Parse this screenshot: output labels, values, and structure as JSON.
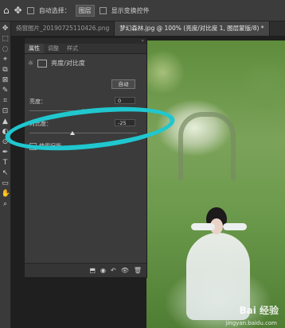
{
  "options_bar": {
    "home": "⌂",
    "move_tool": "✥",
    "auto_select_label": "自动选择：",
    "auto_select_value": "图层",
    "show_transform_label": "显示变换控件"
  },
  "doc_tabs": [
    {
      "label": "倚窗图片_20190725110426.png",
      "active": false
    },
    {
      "label": "梦幻森林.jpg @ 100% (亮度/对比度 1, 图层蒙版/8) *",
      "active": true
    }
  ],
  "tools": [
    "✥",
    "⬚",
    "◌",
    "⌖",
    "⧉",
    "⊠",
    "✎",
    "⌗",
    "⊡",
    "▲",
    "◐",
    "⊙",
    "✒",
    "T",
    "↖",
    "▭",
    "✋",
    "⌕"
  ],
  "properties_panel": {
    "tabs": [
      "属性",
      "调整",
      "样式"
    ],
    "header_title": "亮度/对比度",
    "auto_button": "自动",
    "brightness_label": "亮度：",
    "brightness_value": "0",
    "contrast_label": "对比度：",
    "contrast_value": "-25",
    "use_legacy_label": "使用旧版",
    "bottom_icons": [
      "⬒",
      "◉",
      "↶",
      "👁",
      "🗑"
    ]
  },
  "watermark": {
    "brand": "Bai 经验",
    "url": "jingyan.baidu.com"
  },
  "annotation_color": "#20c7cf"
}
